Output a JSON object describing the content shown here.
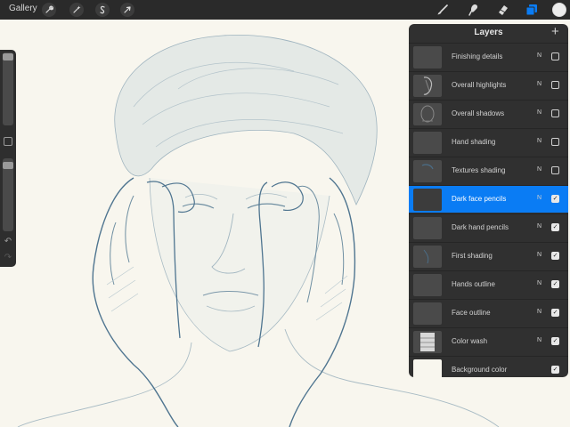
{
  "topbar": {
    "gallery_label": "Gallery",
    "left_tools": [
      "wrench-icon",
      "magic-wand-icon",
      "selection-icon",
      "transform-arrow-icon"
    ],
    "right_tools": [
      "brush-icon",
      "smudge-icon",
      "eraser-icon",
      "layers-icon"
    ],
    "active_tool": "layers-icon",
    "current_color": "#ececec",
    "accent": "#0a7cf4"
  },
  "sidebar": {
    "brush_size_level": 0.98,
    "opacity_level": 0.95,
    "undo_icon": "undo-icon",
    "redo_icon": "redo-icon"
  },
  "layers": {
    "title": "Layers",
    "add_label": "+",
    "items": [
      {
        "name": "Finishing details",
        "blend": "N",
        "visible": false,
        "selected": false
      },
      {
        "name": "Overall highlights",
        "blend": "N",
        "visible": false,
        "selected": false
      },
      {
        "name": "Overall shadows",
        "blend": "N",
        "visible": false,
        "selected": false
      },
      {
        "name": "Hand shading",
        "blend": "N",
        "visible": false,
        "selected": false
      },
      {
        "name": "Textures shading",
        "blend": "N",
        "visible": false,
        "selected": false
      },
      {
        "name": "Dark face pencils",
        "blend": "N",
        "visible": true,
        "selected": true
      },
      {
        "name": "Dark hand pencils",
        "blend": "N",
        "visible": true,
        "selected": false
      },
      {
        "name": "First shading",
        "blend": "N",
        "visible": true,
        "selected": false
      },
      {
        "name": "Hands outline",
        "blend": "N",
        "visible": true,
        "selected": false
      },
      {
        "name": "Face outline",
        "blend": "N",
        "visible": true,
        "selected": false
      },
      {
        "name": "Color wash",
        "blend": "N",
        "visible": true,
        "selected": false
      },
      {
        "name": "Background color",
        "blend": "",
        "visible": true,
        "selected": false
      }
    ]
  },
  "canvas": {
    "background": "#f8f6ee",
    "line_color": "#5a7f96"
  }
}
